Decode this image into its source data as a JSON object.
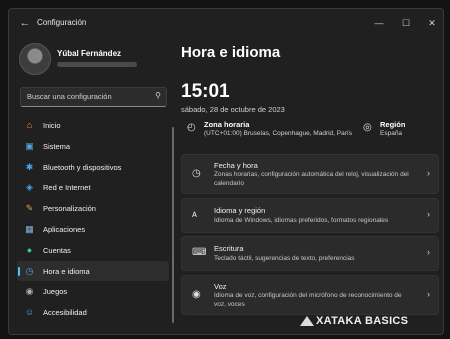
{
  "window": {
    "title": "Configuración"
  },
  "profile": {
    "name": "Yúbal Fernández"
  },
  "search": {
    "placeholder": "Buscar una configuración"
  },
  "sidebar": {
    "items": [
      {
        "label": "Inicio",
        "icon": "home-icon",
        "color": "#e8a23a"
      },
      {
        "label": "Sistema",
        "icon": "system-icon",
        "color": "#4aa8e8"
      },
      {
        "label": "Bluetooth y dispositivos",
        "icon": "bluetooth-icon",
        "color": "#4aa8e8"
      },
      {
        "label": "Red e Internet",
        "icon": "wifi-icon",
        "color": "#4aa8e8"
      },
      {
        "label": "Personalización",
        "icon": "brush-icon",
        "color": "#d9a05b"
      },
      {
        "label": "Aplicaciones",
        "icon": "apps-icon",
        "color": "#8ab4d8"
      },
      {
        "label": "Cuentas",
        "icon": "accounts-icon",
        "color": "#3cc48a"
      },
      {
        "label": "Hora e idioma",
        "icon": "time-language-icon",
        "color": "#4aa8e8",
        "active": true
      },
      {
        "label": "Juegos",
        "icon": "gamepad-icon",
        "color": "#b0b0b0"
      },
      {
        "label": "Accesibilidad",
        "icon": "accessibility-icon",
        "color": "#4aa8e8"
      }
    ]
  },
  "main": {
    "title": "Hora e idioma",
    "time": "15:01",
    "date": "sábado, 28 de octubre de 2023",
    "timezone": {
      "label": "Zona horaria",
      "value": "(UTC+01:00) Bruselas, Copenhague, Madrid, París"
    },
    "region": {
      "label": "Región",
      "value": "España"
    },
    "cards": [
      {
        "title": "Fecha y hora",
        "desc": "Zonas horarias, configuración automática del reloj, visualización del calendario",
        "icon": "clock-calendar-icon"
      },
      {
        "title": "Idioma y región",
        "desc": "Idioma de Windows, idiomas preferidos, formatos regionales",
        "icon": "language-icon"
      },
      {
        "title": "Escritura",
        "desc": "Teclado táctil, sugerencias de texto, preferencias",
        "icon": "keyboard-icon"
      },
      {
        "title": "Voz",
        "desc": "Idioma de voz, configuración del micrófono de reconocimiento de voz, voces",
        "icon": "voice-icon"
      }
    ]
  },
  "watermark": {
    "text": "XATAKA BASICS"
  },
  "colors": {
    "accent": "#4cc2ff",
    "background": "#202020",
    "card": "#2b2b2b"
  }
}
